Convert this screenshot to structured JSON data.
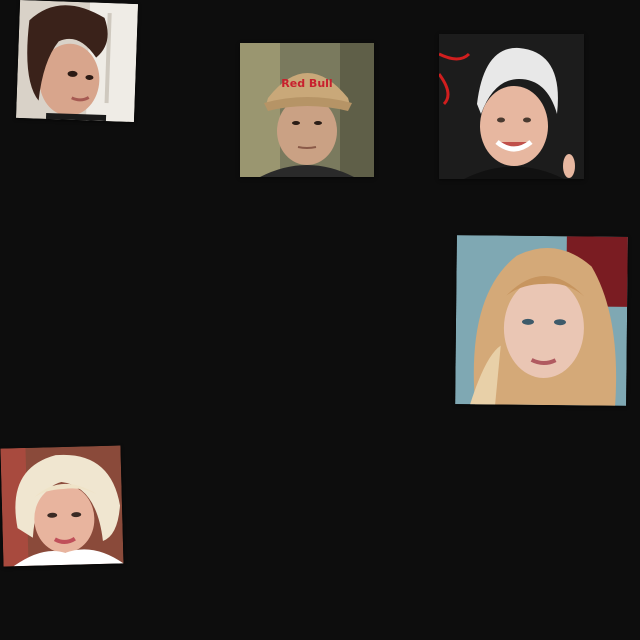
{
  "photos": [
    {
      "id": "p1",
      "subject": "portrait-dark-hair-woman"
    },
    {
      "id": "p2",
      "subject": "portrait-man-cap",
      "cap_text": "Red Bull"
    },
    {
      "id": "p3",
      "subject": "portrait-white-hair-woman"
    },
    {
      "id": "p4",
      "subject": "portrait-blonde-woman"
    },
    {
      "id": "p5",
      "subject": "portrait-platinum-hair-woman"
    }
  ],
  "background_color": "#0d0d0d"
}
